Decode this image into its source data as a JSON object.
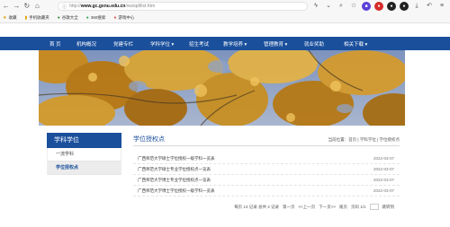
{
  "browser": {
    "url_scheme": "http://",
    "url_host": "www.gc.gxnu.edu.cn",
    "url_path": "/xwxqd/list.htm",
    "bookmarks": [
      {
        "label": "收藏",
        "icon": "star-icon"
      },
      {
        "label": "手机收藏夹",
        "icon": "folder-icon"
      },
      {
        "label": "谷歌大全",
        "icon": "folder-icon"
      },
      {
        "label": "360搜索",
        "icon": "folder-icon"
      },
      {
        "label": "游戏中心",
        "icon": "folder-icon"
      }
    ]
  },
  "nav": {
    "items": [
      "首 页",
      "机构概况",
      "党建专栏",
      "学科学位",
      "招生考试",
      "教学培养",
      "管理教育",
      "就业奖助",
      "相关下载"
    ],
    "dropdown_marker": "▾"
  },
  "sidebar": {
    "title": "学科学位",
    "items": [
      {
        "label": "一流学科",
        "active": false
      },
      {
        "label": "学位授权点",
        "active": true
      }
    ]
  },
  "content": {
    "title": "学位授权点",
    "breadcrumb": "当前位置：首页 | 学科学位 | 学位授权点",
    "rows": [
      {
        "title": "广西师范大学硕士学位授权一级学科一览表",
        "date": "2022-03-07"
      },
      {
        "title": "广西师范大学硕士专业学位授权点一览表",
        "date": "2022-03-07"
      },
      {
        "title": "广西师范大学博士专业学位授权点一览表",
        "date": "2022-03-07"
      },
      {
        "title": "广西师范大学博士学位授权一级学科一览表",
        "date": "2022-03-07"
      }
    ],
    "pager": {
      "summary": "每页 14 记录  总共 4 记录",
      "first": "第一页",
      "prev": "<<上一页",
      "next": "下一页>>",
      "last": "尾页",
      "page": "页码 1/1",
      "jump": "跳转到"
    }
  }
}
